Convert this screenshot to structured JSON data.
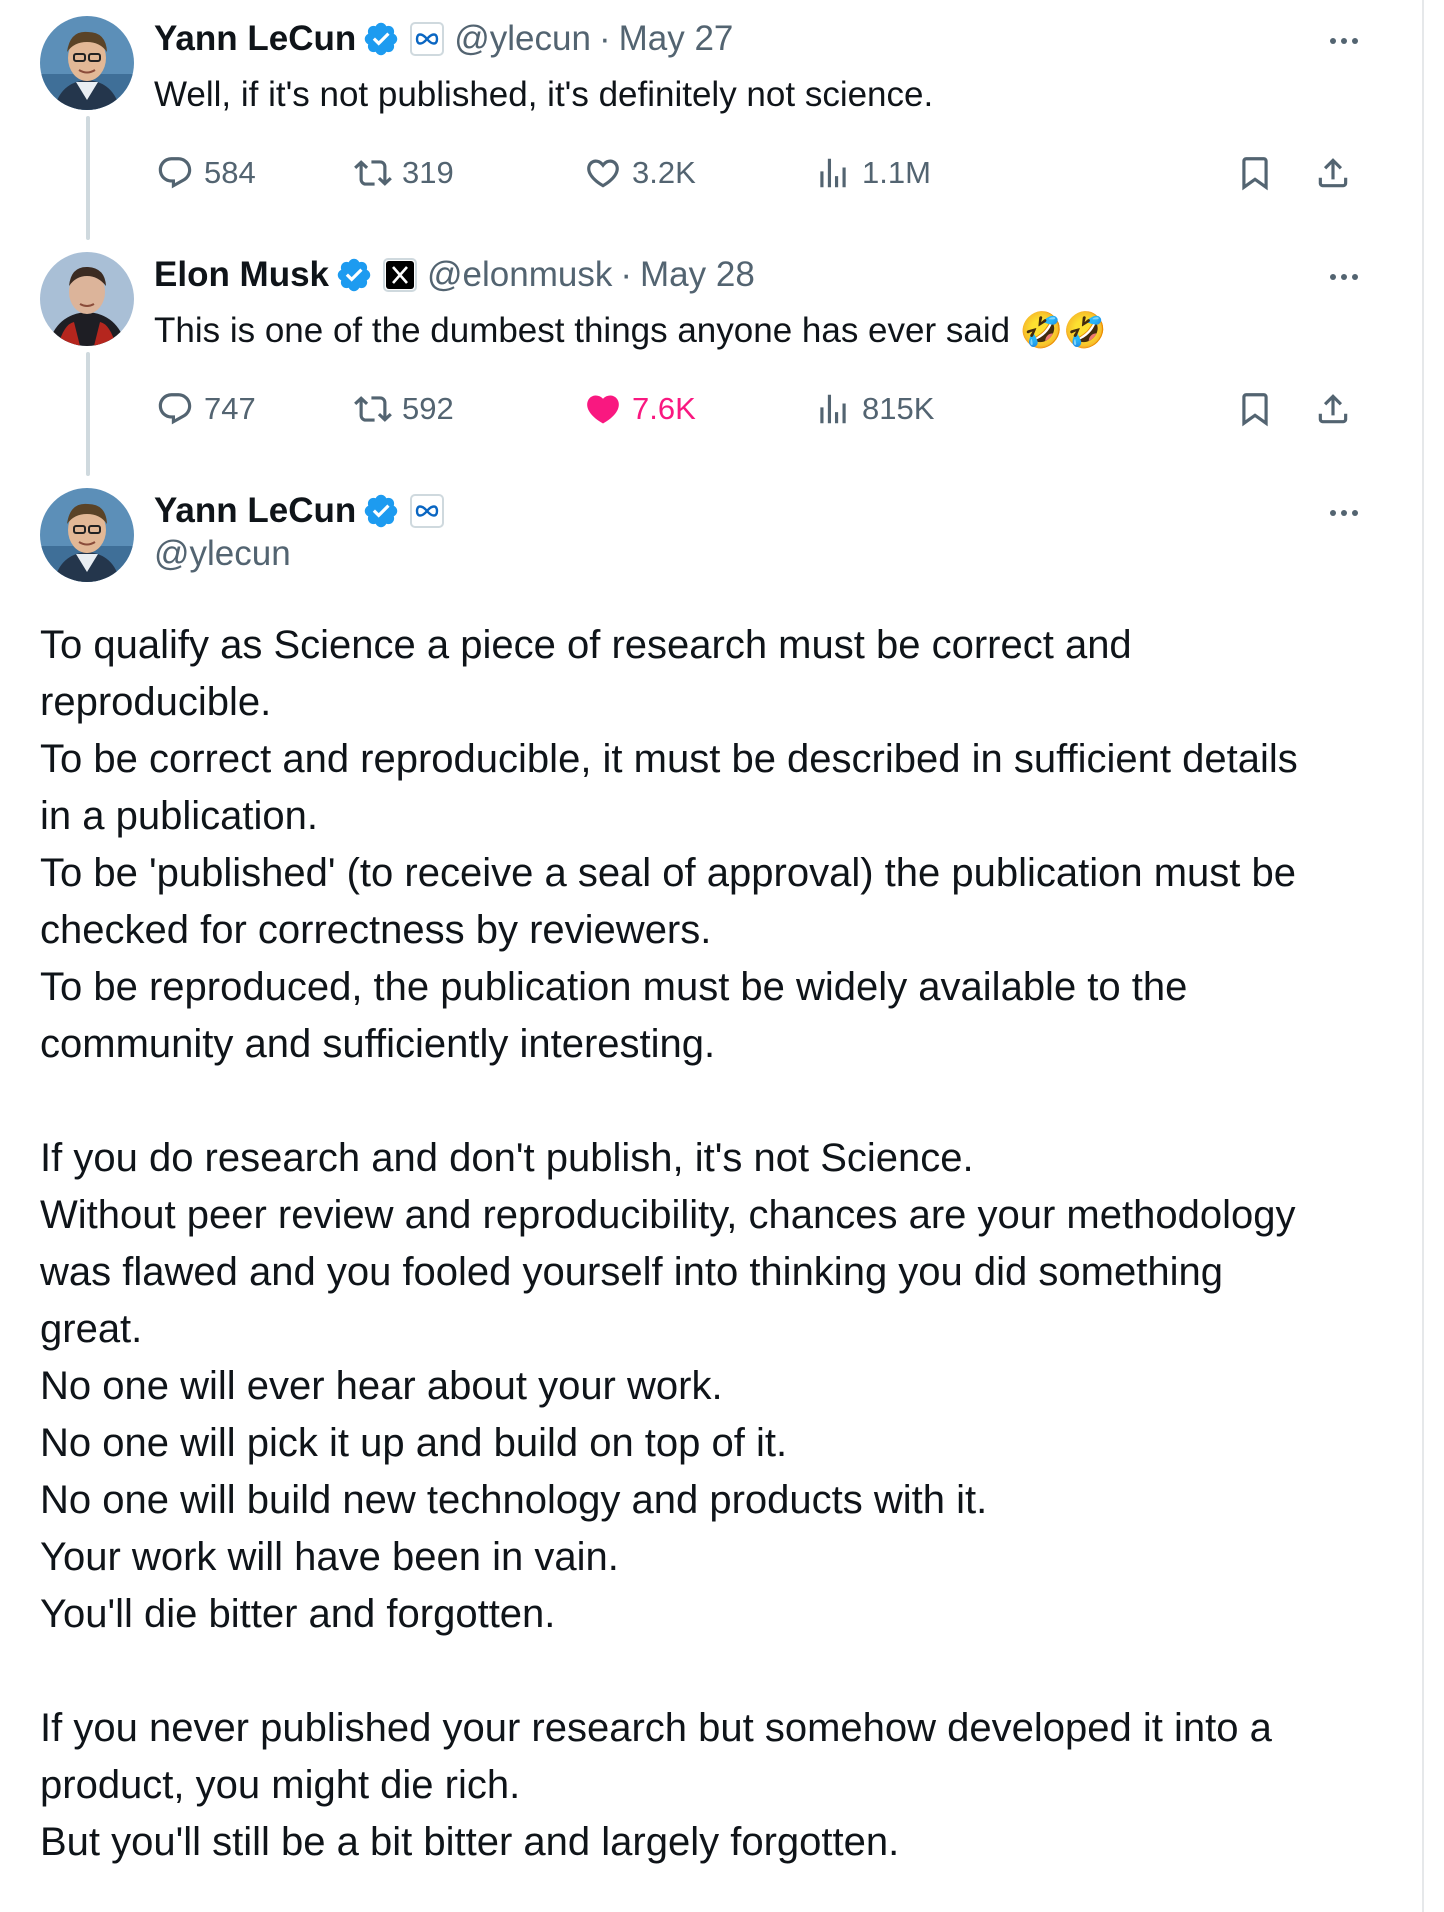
{
  "tweets": [
    {
      "name": "Yann LeCun",
      "handle": "@ylecun",
      "separator": "·",
      "date": "May 27",
      "text": "Well, if it's not published, it's definitely not science.",
      "replies": "584",
      "reposts": "319",
      "likes": "3.2K",
      "views": "1.1M",
      "affiliation_icon": "meta-logo-icon"
    },
    {
      "name": "Elon Musk",
      "handle": "@elonmusk",
      "separator": "·",
      "date": "May 28",
      "text": "This is one of the dumbest things anyone has ever said",
      "emoji": "🤣🤣",
      "replies": "747",
      "reposts": "592",
      "likes": "7.6K",
      "liked": true,
      "views": "815K",
      "affiliation_icon": "x-logo-icon"
    }
  ],
  "main_tweet": {
    "name": "Yann LeCun",
    "handle": "@ylecun",
    "affiliation_icon": "meta-logo-icon",
    "paragraphs": [
      [
        "To qualify as Science a piece of research must be correct and",
        "reproducible.",
        "To be correct and reproducible, it must be described in sufficient details",
        "in a publication.",
        "To be 'published' (to receive a seal of approval) the publication must be",
        "checked for correctness by reviewers.",
        "To be reproduced, the publication must be widely available to the",
        "community and sufficiently interesting."
      ],
      [
        "If you do research and don't publish, it's not Science.",
        "Without peer review and reproducibility, chances are your methodology",
        "was flawed and you fooled yourself into thinking you did something",
        "great.",
        "No one will ever hear about your work.",
        "No one will pick it up and build on top of it.",
        "No one will build new technology and products with it.",
        "Your work will have been in vain.",
        "You'll die bitter and forgotten."
      ],
      [
        "If you never published your research but somehow developed it into a",
        "product, you might die rich.",
        "But you'll still be a bit bitter and largely forgotten."
      ]
    ]
  },
  "colors": {
    "text": "#0f1419",
    "secondary": "#536471",
    "verified": "#1d9bf0",
    "like_active": "#f91880",
    "thread_line": "#cfd9de"
  }
}
